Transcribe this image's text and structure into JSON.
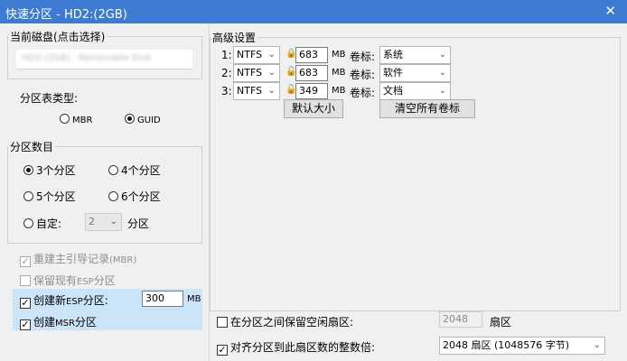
{
  "window": {
    "title": "快速分区 - HD2:(2GB)",
    "close_glyph": "✕"
  },
  "disk": {
    "label": "当前磁盘(点击选择)",
    "value": "HD2:(2GB) · Removable Disk"
  },
  "partition_type": {
    "label": "分区表类型:",
    "options": [
      {
        "label": "MBR",
        "selected": false
      },
      {
        "label": "GUID",
        "selected": true
      }
    ]
  },
  "partition_count": {
    "label": "分区数目",
    "options": [
      {
        "label": "3个分区",
        "selected": true
      },
      {
        "label": "4个分区",
        "selected": false
      },
      {
        "label": "5个分区",
        "selected": false
      },
      {
        "label": "6个分区",
        "selected": false
      }
    ],
    "custom_label": "自定:",
    "custom_value": "2",
    "custom_suffix": "分区"
  },
  "options": {
    "rebuild_mbr": {
      "label_main": "重建主引导记录",
      "label_paren": "(MBR)",
      "checked": true,
      "disabled": true
    },
    "keep_esp": {
      "label_main": "保留现有",
      "label_mid": "ESP",
      "label_end": "分区",
      "checked": false,
      "disabled": true
    },
    "create_esp": {
      "label_main": "创建新",
      "label_mid": "ESP",
      "label_end": "分区:",
      "checked": true,
      "size_value": "300",
      "unit": "MB"
    },
    "create_msr": {
      "label_main": "创建",
      "label_mid": "MSR",
      "label_end": "分区",
      "checked": true
    }
  },
  "advanced": {
    "label": "高级设置",
    "rows": [
      {
        "index": "1:",
        "fs": "NTFS",
        "size": "683",
        "unit": "MB",
        "label_caption": "卷标:",
        "volume": "系统"
      },
      {
        "index": "2:",
        "fs": "NTFS",
        "size": "683",
        "unit": "MB",
        "label_caption": "卷标:",
        "volume": "软件"
      },
      {
        "index": "3:",
        "fs": "NTFS",
        "size": "349",
        "unit": "MB",
        "label_caption": "卷标:",
        "volume": "文档"
      }
    ],
    "default_size_button": "默认大小",
    "clear_labels_button": "清空所有卷标"
  },
  "footer": {
    "reserve_label": "在分区之间保留空闲扇区:",
    "reserve_checked": false,
    "reserve_value": "2048",
    "reserve_unit": "扇区",
    "align_label": "对齐分区到此扇区数的整数倍:",
    "align_checked": true,
    "align_value": "2048 扇区 (1048576 字节)"
  },
  "colors": {
    "titlebar": "#3d7ad2",
    "highlight": "#cce4f7"
  }
}
